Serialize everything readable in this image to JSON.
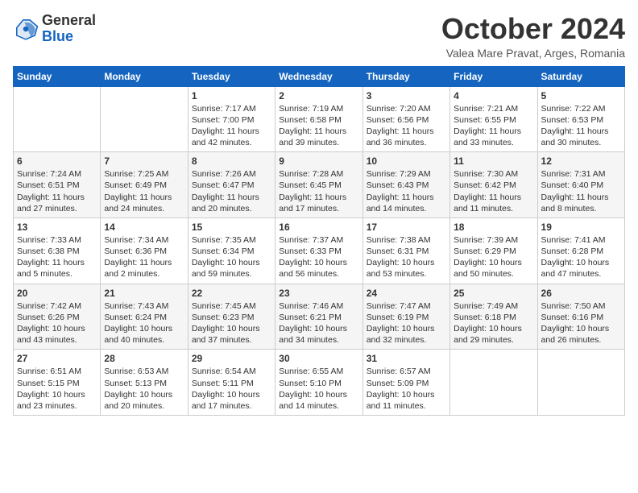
{
  "header": {
    "logo_line1": "General",
    "logo_line2": "Blue",
    "month": "October 2024",
    "location": "Valea Mare Pravat, Arges, Romania"
  },
  "days_of_week": [
    "Sunday",
    "Monday",
    "Tuesday",
    "Wednesday",
    "Thursday",
    "Friday",
    "Saturday"
  ],
  "weeks": [
    [
      {
        "day": "",
        "info": ""
      },
      {
        "day": "",
        "info": ""
      },
      {
        "day": "1",
        "info": "Sunrise: 7:17 AM\nSunset: 7:00 PM\nDaylight: 11 hours and 42 minutes."
      },
      {
        "day": "2",
        "info": "Sunrise: 7:19 AM\nSunset: 6:58 PM\nDaylight: 11 hours and 39 minutes."
      },
      {
        "day": "3",
        "info": "Sunrise: 7:20 AM\nSunset: 6:56 PM\nDaylight: 11 hours and 36 minutes."
      },
      {
        "day": "4",
        "info": "Sunrise: 7:21 AM\nSunset: 6:55 PM\nDaylight: 11 hours and 33 minutes."
      },
      {
        "day": "5",
        "info": "Sunrise: 7:22 AM\nSunset: 6:53 PM\nDaylight: 11 hours and 30 minutes."
      }
    ],
    [
      {
        "day": "6",
        "info": "Sunrise: 7:24 AM\nSunset: 6:51 PM\nDaylight: 11 hours and 27 minutes."
      },
      {
        "day": "7",
        "info": "Sunrise: 7:25 AM\nSunset: 6:49 PM\nDaylight: 11 hours and 24 minutes."
      },
      {
        "day": "8",
        "info": "Sunrise: 7:26 AM\nSunset: 6:47 PM\nDaylight: 11 hours and 20 minutes."
      },
      {
        "day": "9",
        "info": "Sunrise: 7:28 AM\nSunset: 6:45 PM\nDaylight: 11 hours and 17 minutes."
      },
      {
        "day": "10",
        "info": "Sunrise: 7:29 AM\nSunset: 6:43 PM\nDaylight: 11 hours and 14 minutes."
      },
      {
        "day": "11",
        "info": "Sunrise: 7:30 AM\nSunset: 6:42 PM\nDaylight: 11 hours and 11 minutes."
      },
      {
        "day": "12",
        "info": "Sunrise: 7:31 AM\nSunset: 6:40 PM\nDaylight: 11 hours and 8 minutes."
      }
    ],
    [
      {
        "day": "13",
        "info": "Sunrise: 7:33 AM\nSunset: 6:38 PM\nDaylight: 11 hours and 5 minutes."
      },
      {
        "day": "14",
        "info": "Sunrise: 7:34 AM\nSunset: 6:36 PM\nDaylight: 11 hours and 2 minutes."
      },
      {
        "day": "15",
        "info": "Sunrise: 7:35 AM\nSunset: 6:34 PM\nDaylight: 10 hours and 59 minutes."
      },
      {
        "day": "16",
        "info": "Sunrise: 7:37 AM\nSunset: 6:33 PM\nDaylight: 10 hours and 56 minutes."
      },
      {
        "day": "17",
        "info": "Sunrise: 7:38 AM\nSunset: 6:31 PM\nDaylight: 10 hours and 53 minutes."
      },
      {
        "day": "18",
        "info": "Sunrise: 7:39 AM\nSunset: 6:29 PM\nDaylight: 10 hours and 50 minutes."
      },
      {
        "day": "19",
        "info": "Sunrise: 7:41 AM\nSunset: 6:28 PM\nDaylight: 10 hours and 47 minutes."
      }
    ],
    [
      {
        "day": "20",
        "info": "Sunrise: 7:42 AM\nSunset: 6:26 PM\nDaylight: 10 hours and 43 minutes."
      },
      {
        "day": "21",
        "info": "Sunrise: 7:43 AM\nSunset: 6:24 PM\nDaylight: 10 hours and 40 minutes."
      },
      {
        "day": "22",
        "info": "Sunrise: 7:45 AM\nSunset: 6:23 PM\nDaylight: 10 hours and 37 minutes."
      },
      {
        "day": "23",
        "info": "Sunrise: 7:46 AM\nSunset: 6:21 PM\nDaylight: 10 hours and 34 minutes."
      },
      {
        "day": "24",
        "info": "Sunrise: 7:47 AM\nSunset: 6:19 PM\nDaylight: 10 hours and 32 minutes."
      },
      {
        "day": "25",
        "info": "Sunrise: 7:49 AM\nSunset: 6:18 PM\nDaylight: 10 hours and 29 minutes."
      },
      {
        "day": "26",
        "info": "Sunrise: 7:50 AM\nSunset: 6:16 PM\nDaylight: 10 hours and 26 minutes."
      }
    ],
    [
      {
        "day": "27",
        "info": "Sunrise: 6:51 AM\nSunset: 5:15 PM\nDaylight: 10 hours and 23 minutes."
      },
      {
        "day": "28",
        "info": "Sunrise: 6:53 AM\nSunset: 5:13 PM\nDaylight: 10 hours and 20 minutes."
      },
      {
        "day": "29",
        "info": "Sunrise: 6:54 AM\nSunset: 5:11 PM\nDaylight: 10 hours and 17 minutes."
      },
      {
        "day": "30",
        "info": "Sunrise: 6:55 AM\nSunset: 5:10 PM\nDaylight: 10 hours and 14 minutes."
      },
      {
        "day": "31",
        "info": "Sunrise: 6:57 AM\nSunset: 5:09 PM\nDaylight: 10 hours and 11 minutes."
      },
      {
        "day": "",
        "info": ""
      },
      {
        "day": "",
        "info": ""
      }
    ]
  ]
}
